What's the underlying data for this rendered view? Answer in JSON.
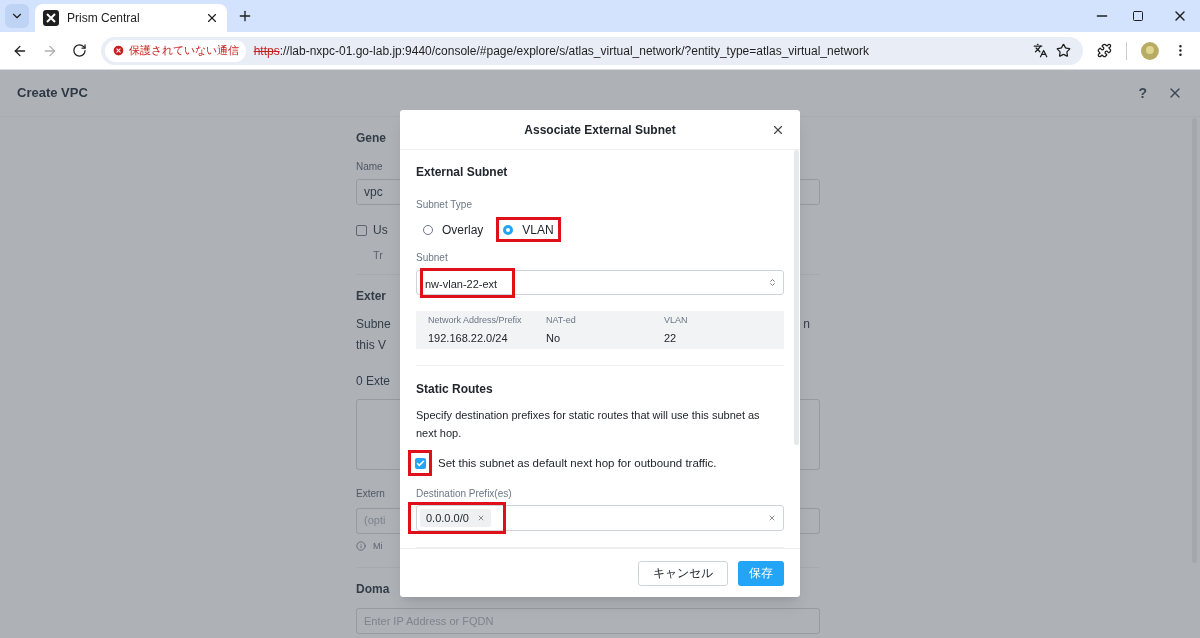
{
  "browser": {
    "tab": {
      "title": "Prism Central"
    },
    "security_chip": "保護されていない通信",
    "address": {
      "scheme": "https",
      "rest": "://lab-nxpc-01.go-lab.jp:9440/console/#page/explore/s/atlas_virtual_network/?entity_type=atlas_virtual_network"
    }
  },
  "page": {
    "title": "Create VPC",
    "help": "?",
    "form": {
      "general_heading": "Gene",
      "name_label": "Name",
      "name_value": "vpc",
      "option_label": "Us",
      "option_checked": false,
      "option_hint": "Tr",
      "external_heading": "Exter",
      "description_line_1": "Subne",
      "description_line_1_tail": "n",
      "description_line_2": "this V",
      "count_label": "0 Exte",
      "external_field_label": "Extern",
      "external_field_placeholder": "(opti",
      "info_note": "Mi",
      "domain_heading": "Doma",
      "domain_placeholder": "Enter IP Address or FQDN"
    }
  },
  "dialog": {
    "title": "Associate External Subnet",
    "section": "External Subnet",
    "subnet_type_label": "Subnet Type",
    "subnet_types": [
      {
        "label": "Overlay",
        "selected": false,
        "highlighted": false
      },
      {
        "label": "VLAN",
        "selected": true,
        "highlighted": true
      }
    ],
    "subnet_label": "Subnet",
    "subnet": {
      "value": "nw-vlan-22-ext",
      "highlighted": true
    },
    "details": [
      {
        "label": "Network Address/Prefix",
        "value": "192.168.22.0/24"
      },
      {
        "label": "NAT-ed",
        "value": "No"
      },
      {
        "label": "VLAN",
        "value": "22"
      }
    ],
    "static_routes": {
      "title": "Static Routes",
      "description": "Specify destination prefixes for static routes that will use this subnet as next hop.",
      "default_hop": {
        "label": "Set this subnet as default next hop for outbound traffic.",
        "checked": true,
        "highlighted": true
      },
      "prefix_label": "Destination Prefix(es)",
      "prefixes": [
        {
          "value": "0.0.0.0/0",
          "highlighted": true
        }
      ]
    },
    "buttons": [
      {
        "label": "キャンセル",
        "kind": "secondary"
      },
      {
        "label": "保存",
        "kind": "primary"
      }
    ]
  }
}
